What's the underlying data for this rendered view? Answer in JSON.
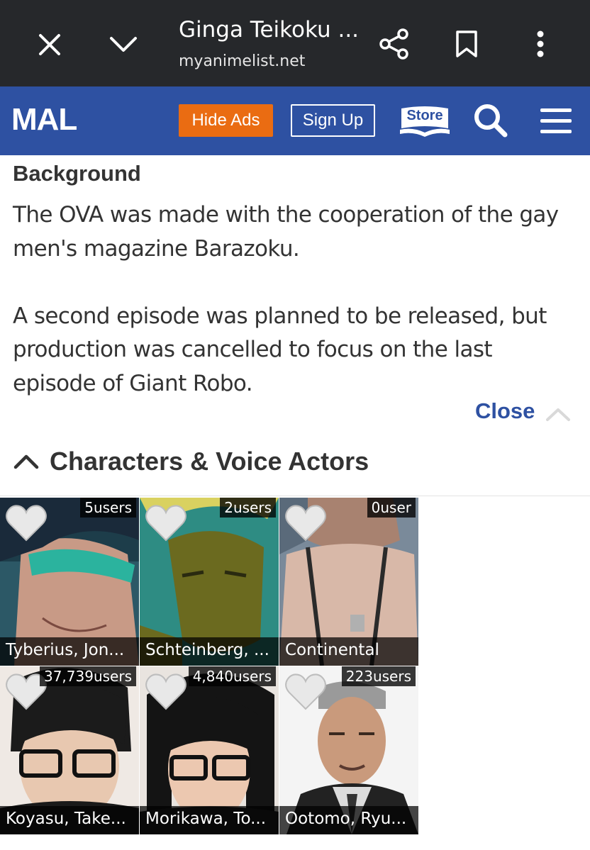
{
  "browser": {
    "title": "Ginga Teikoku ...",
    "url": "myanimelist.net",
    "icons": [
      "close-icon",
      "chevron-down-icon",
      "share-icon",
      "bookmark-icon",
      "more-vert-icon"
    ]
  },
  "header": {
    "logo": "MAL",
    "hide_ads": "Hide Ads",
    "sign_up": "Sign Up",
    "store": "Store",
    "colors": {
      "brand": "#2e51a2",
      "hide_ads": "#ea6c12"
    }
  },
  "background": {
    "heading": "Background",
    "paragraph1": "The OVA was made with the cooperation of the gay men's magazine Barazoku.",
    "paragraph2": "A second episode was planned to be released, but production was cancelled to focus on the last episode of Giant Robo.",
    "close_label": "Close"
  },
  "characters": {
    "heading": "Characters & Voice Actors",
    "characters_row": [
      {
        "name": "Tyberius, Jon...",
        "count": "5users"
      },
      {
        "name": "Schteinberg, ...",
        "count": "2users"
      },
      {
        "name": "Continental",
        "count": "0user"
      }
    ],
    "voice_actors_row": [
      {
        "name": "Koyasu, Take...",
        "count": "37,739users"
      },
      {
        "name": "Morikawa, To...",
        "count": "4,840users"
      },
      {
        "name": "Ootomo, Ryu...",
        "count": "223users"
      }
    ]
  }
}
